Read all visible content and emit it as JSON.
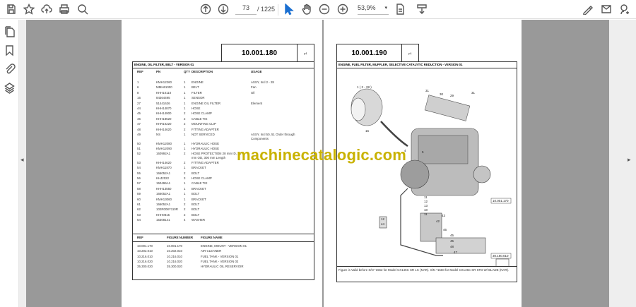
{
  "toolbar": {
    "left_icons": [
      "save-icon",
      "star-icon",
      "upload-icon",
      "print-icon",
      "search-icon"
    ],
    "current_page": "73",
    "total_pages": "/ 1225",
    "zoom": "53,9%",
    "right_icons": [
      "sign-icon",
      "mail-icon",
      "user-add-icon"
    ]
  },
  "sidebar": {
    "icons": [
      "pages-icon",
      "bookmark-icon",
      "attachment-icon",
      "layers-icon"
    ]
  },
  "left_page": {
    "figure_number": "10.001.180",
    "page_label": "p1",
    "title": "ENGINE, OIL FILTER, BELT - VERSION 01",
    "headers": {
      "ref": "REF",
      "pn": "PN",
      "qty": "QTY",
      "desc": "DESCRIPTION",
      "usage": "USAGE"
    },
    "rows": [
      {
        "ref": "1",
        "pn": "KMH12260",
        "qty": "1",
        "desc": "ENGINE",
        "usage": "ASSY, Incl 2 - 28"
      },
      {
        "ref": "6",
        "pn": "MMH61000",
        "qty": "1",
        "desc": "BELT",
        "usage": "Fan"
      },
      {
        "ref": "8",
        "pn": "KHH10110",
        "qty": "1",
        "desc": "FILTER",
        "usage": "Oil"
      },
      {
        "ref": "16",
        "pn": "84364495",
        "qty": "1",
        "desc": "SENSOR",
        "usage": ""
      },
      {
        "ref": "27",
        "pn": "51441626",
        "qty": "1",
        "desc": "ENGINE OIL FILTER",
        "usage": "Element"
      },
      {
        "ref": "44",
        "pn": "KHH14870",
        "qty": "1",
        "desc": "HOSE",
        "usage": ""
      },
      {
        "ref": "45",
        "pn": "KHH14900",
        "qty": "2",
        "desc": "HOSE CLAMP",
        "usage": ""
      },
      {
        "ref": "46",
        "pn": "KHH18520",
        "qty": "2",
        "desc": "CABLE TIE",
        "usage": ""
      },
      {
        "ref": "47",
        "pn": "KHR10220",
        "qty": "2",
        "desc": "MOUNTING CLIP",
        "usage": ""
      },
      {
        "ref": "48",
        "pn": "KHH14620",
        "qty": "2",
        "desc": "FITTING ADAPTER",
        "usage": ""
      },
      {
        "ref": "49",
        "pn": "NS",
        "qty": "1",
        "desc": "NOT SERVICED",
        "usage": "ASSY, Incl 50, 51 Order through",
        "usage2": "Components"
      },
      {
        "ref": "50",
        "pn": "KMH12080",
        "qty": "1",
        "desc": "HYDRAULIC HOSE",
        "usage": ""
      },
      {
        "ref": "51",
        "pn": "KMH12090",
        "qty": "1",
        "desc": "HYDRAULIC HOSE",
        "usage": ""
      },
      {
        "ref": "52",
        "pn": "160992A1",
        "qty": "2",
        "desc": "HOSE PROTECTION 28 mm ID, 34",
        "desc2": "mm OD, 300 mm Length",
        "usage": ""
      },
      {
        "ref": "53",
        "pn": "KHH14620",
        "qty": "2",
        "desc": "FITTING ADAPTER",
        "usage": ""
      },
      {
        "ref": "54",
        "pn": "KMH11870",
        "qty": "1",
        "desc": "BRACKET",
        "usage": ""
      },
      {
        "ref": "55",
        "pn": "166052A1",
        "qty": "2",
        "desc": "BOLT",
        "usage": ""
      },
      {
        "ref": "56",
        "pn": "KHJ2022",
        "qty": "3",
        "desc": "HOSE CLAMP",
        "usage": ""
      },
      {
        "ref": "57",
        "pn": "150496A1",
        "qty": "1",
        "desc": "CABLE TIE",
        "usage": ""
      },
      {
        "ref": "58",
        "pn": "KHH13550",
        "qty": "1",
        "desc": "BRACKET",
        "usage": ""
      },
      {
        "ref": "59",
        "pn": "166052A1",
        "qty": "1",
        "desc": "BOLT",
        "usage": ""
      },
      {
        "ref": "60",
        "pn": "KMH13060",
        "qty": "1",
        "desc": "BRACKET",
        "usage": ""
      },
      {
        "ref": "61",
        "pn": "166052A1",
        "qty": "2",
        "desc": "BOLT",
        "usage": ""
      },
      {
        "ref": "62",
        "pn": "102R008Y110R",
        "qty": "2",
        "desc": "BOLT",
        "usage": ""
      },
      {
        "ref": "63",
        "pn": "KHH0815",
        "qty": "2",
        "desc": "BOLT",
        "usage": ""
      },
      {
        "ref": "64",
        "pn": "15308141",
        "qty": "4",
        "desc": "WASHER",
        "usage": ""
      }
    ],
    "ref_headers": {
      "ref": "REF",
      "fig": "FIGURE NUMBER",
      "name": "FIGURE NAME"
    },
    "ref_rows": [
      {
        "ref": "10.001.170",
        "fig": "10.001.170",
        "name": "ENGINE, MOUNT - VERSION 01"
      },
      {
        "ref": "10.202.010",
        "fig": "10.202.010",
        "name": "AIR CLEANER"
      },
      {
        "ref": "10.216.010",
        "fig": "10.216.010",
        "name": "FUEL TANK - VERSION 01"
      },
      {
        "ref": "10.216.020",
        "fig": "10.216.020",
        "name": "FUEL TANK - VERSION 02"
      },
      {
        "ref": "35.300.020",
        "fig": "35.300.020",
        "name": "HYDRAULIC OIL RESERVOIR"
      }
    ]
  },
  "right_page": {
    "figure_number": "10.001.190",
    "page_label": "p1",
    "title": "ENGINE, FUEL FILTER, MUFFLER, SELECTIVE CATALYTIC REDUCTION - VERSION 01",
    "callouts": [
      "1 ( 2 - 28 )",
      "31",
      "30",
      "29",
      "31",
      "16",
      "4",
      "5",
      "11",
      "12",
      "13",
      "10",
      "11",
      "42",
      "43",
      "12",
      "44",
      "46",
      "45",
      "45",
      "48",
      "47",
      "10.001.170",
      "30.160.010"
    ],
    "caption": "Figure is Valid before S/N *1562 for Model CX145C SR LC (NAR). S/N *1560 for Model CX145C SR STD W/ BLADE (NAR)."
  },
  "watermark": "machinecatalogic.com"
}
